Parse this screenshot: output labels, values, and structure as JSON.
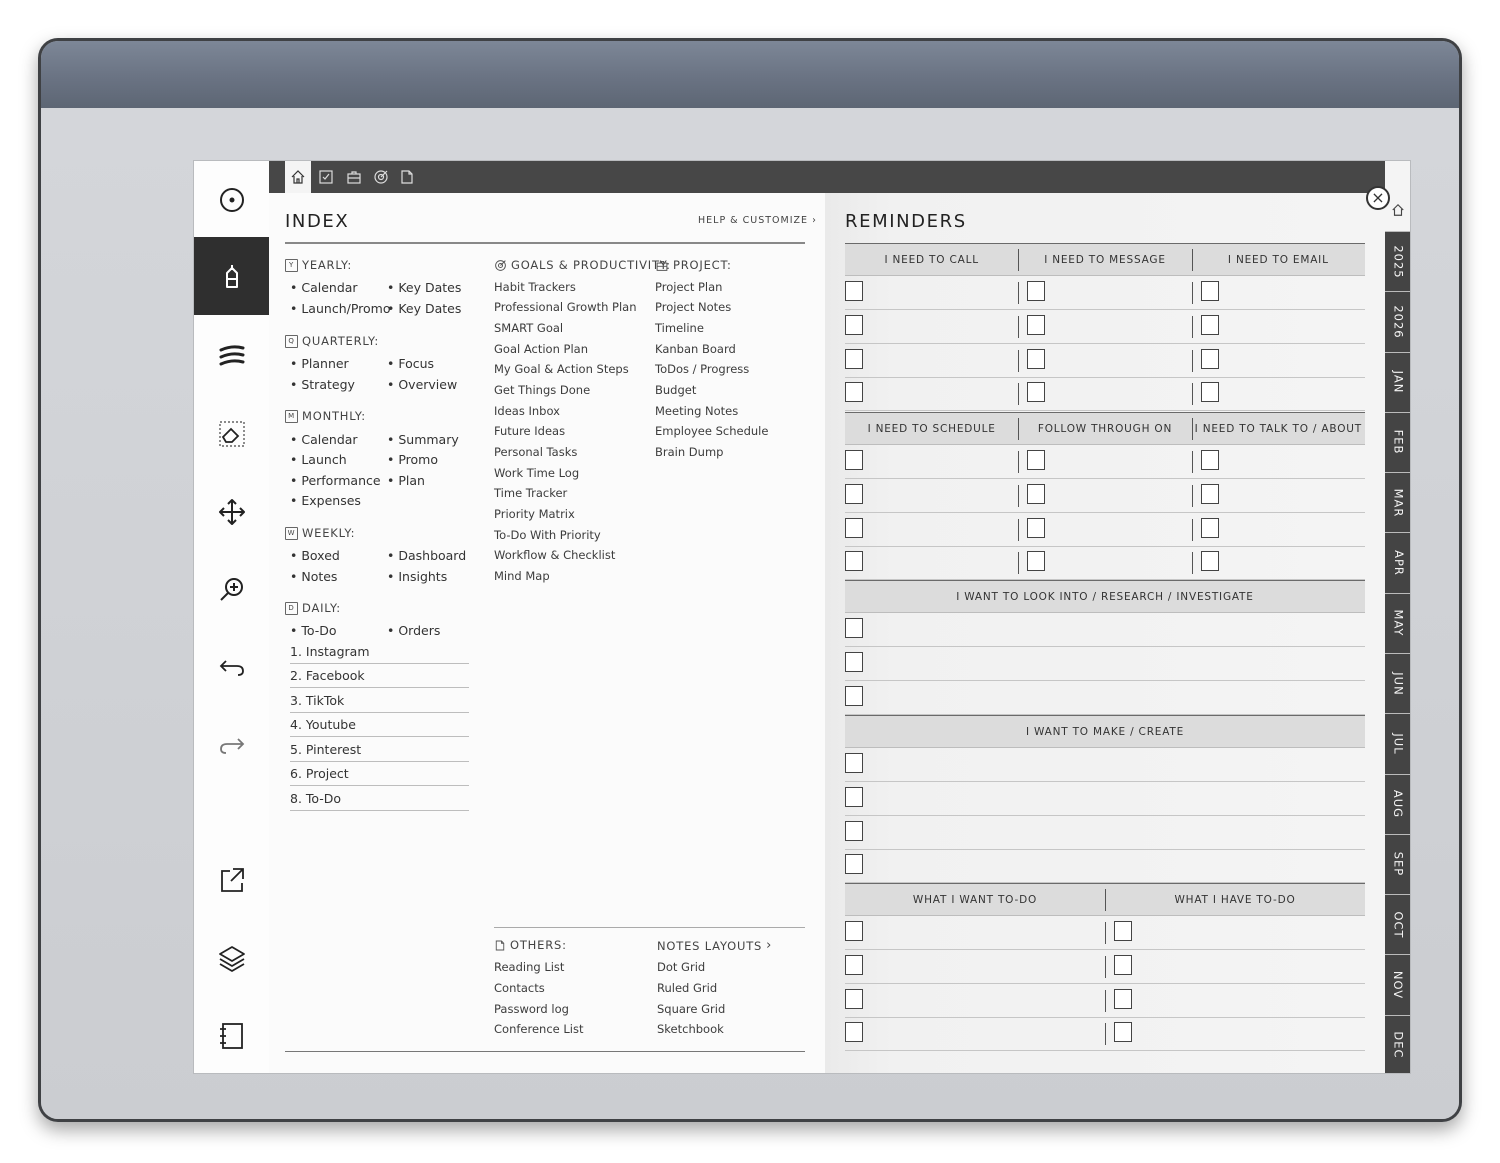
{
  "toolbar": {
    "tools": [
      "pen-tool-icon",
      "highlighter-tool-icon",
      "strokes-tool-icon",
      "lasso-eraser-icon",
      "move-icon",
      "zoom-in-icon",
      "undo-icon",
      "redo-icon",
      "share-icon",
      "layers-icon",
      "notebook-icon"
    ]
  },
  "topbar": {
    "icons": [
      "home-icon",
      "checklist-icon",
      "briefcase-icon",
      "goal-target-icon",
      "document-icon"
    ]
  },
  "index": {
    "title": "INDEX",
    "help_label": "HELP & CUSTOMIZE",
    "yearly": {
      "title": "YEARLY:",
      "badge": "Y",
      "items": [
        "• Calendar",
        "• Key Dates",
        "• Launch/Promo",
        "• Key Dates"
      ]
    },
    "quarterly": {
      "title": "QUARTERLY:",
      "badge": "Q",
      "items": [
        "• Planner",
        "• Focus",
        "• Strategy",
        "• Overview"
      ]
    },
    "monthly": {
      "title": "MONTHLY:",
      "badge": "M",
      "items": [
        "• Calendar",
        "• Summary",
        "• Launch",
        "• Promo",
        "• Performance",
        "• Plan",
        "• Expenses"
      ]
    },
    "weekly": {
      "title": "WEEKLY:",
      "badge": "W",
      "items": [
        "• Boxed",
        "• Dashboard",
        "• Notes",
        "• Insights"
      ]
    },
    "daily": {
      "title": "DAILY:",
      "badge": "D",
      "items": [
        "• To-Do",
        "• Orders"
      ],
      "numbered": [
        "1. Instagram",
        "2. Facebook",
        "3. TikTok",
        "4. Youtube",
        "5. Pinterest",
        "6. Project",
        "8. To-Do"
      ]
    },
    "goals": {
      "title": "GOALS & PRODUCTIVITY:",
      "items": [
        "Habit Trackers",
        "Professional Growth Plan",
        "SMART Goal",
        "Goal Action Plan",
        "My Goal & Action Steps",
        "Get Things Done",
        "Ideas Inbox",
        "Future Ideas",
        "Personal Tasks",
        "Work Time Log",
        "Time Tracker",
        "Priority Matrix",
        "To-Do With Priority",
        "Workflow & Checklist",
        "Mind Map"
      ]
    },
    "project": {
      "title": "PROJECT:",
      "items": [
        "Project Plan",
        "Project Notes",
        "Timeline",
        "Kanban Board",
        "ToDos / Progress",
        "Budget",
        "Meeting Notes",
        "Employee Schedule",
        "Brain Dump"
      ]
    },
    "others": {
      "title": "OTHERS:",
      "items": [
        "Reading List",
        "Contacts",
        "Password log",
        "Conference List"
      ]
    },
    "notes_layouts": {
      "title": "NOTES LAYOUTS",
      "items": [
        "Dot Grid",
        "Ruled Grid",
        "Square Grid",
        "Sketchbook"
      ]
    }
  },
  "reminders": {
    "title": "REMINDERS",
    "row1": [
      "I NEED TO CALL",
      "I NEED TO MESSAGE",
      "I NEED TO EMAIL"
    ],
    "row2": [
      "I NEED TO SCHEDULE",
      "FOLLOW THROUGH ON",
      "I NEED TO TALK TO / ABOUT"
    ],
    "research": "I WANT TO LOOK INTO / RESEARCH / INVESTIGATE",
    "create": "I WANT TO MAKE / CREATE",
    "todo": [
      "WHAT I WANT TO-DO",
      "WHAT I HAVE TO-DO"
    ]
  },
  "side_tabs": [
    "2025",
    "2026",
    "JAN",
    "FEB",
    "MAR",
    "APR",
    "MAY",
    "JUN",
    "JUL",
    "AUG",
    "SEP",
    "OCT",
    "NOV",
    "DEC"
  ]
}
